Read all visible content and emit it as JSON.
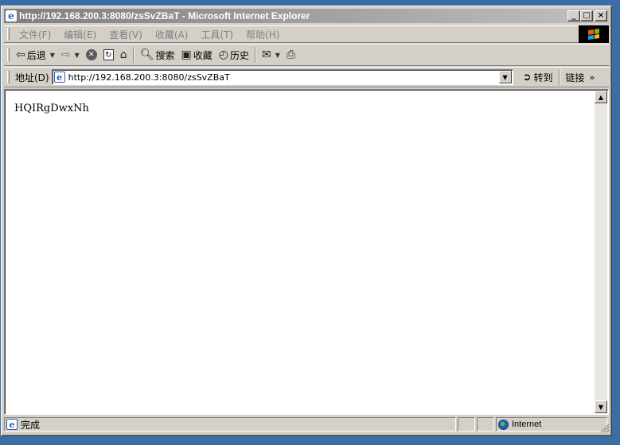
{
  "window": {
    "title": "http://192.168.200.3:8080/zsSvZBaT - Microsoft Internet Explorer",
    "minimize_glyph": "_",
    "maximize_glyph": "□",
    "close_glyph": "×"
  },
  "menu": {
    "items": [
      {
        "label": "文件(F)"
      },
      {
        "label": "编辑(E)"
      },
      {
        "label": "查看(V)"
      },
      {
        "label": "收藏(A)"
      },
      {
        "label": "工具(T)"
      },
      {
        "label": "帮助(H)"
      }
    ]
  },
  "toolbar": {
    "back_label": "后退",
    "search_label": "搜索",
    "favorites_label": "收藏",
    "history_label": "历史"
  },
  "address": {
    "label": "地址(D)",
    "value": "http://192.168.200.3:8080/zsSvZBaT",
    "go_label": "转到",
    "links_label": "链接"
  },
  "content": {
    "text": "HQIRgDwxNh"
  },
  "status": {
    "text": "完成",
    "zone": "Internet"
  },
  "icons": {
    "back": "back-arrow-icon",
    "forward": "forward-arrow-icon",
    "stop": "stop-icon",
    "refresh": "refresh-icon",
    "home": "home-icon",
    "search": "search-icon",
    "favorites": "favorites-icon",
    "history": "history-icon",
    "mail": "mail-icon",
    "print": "print-icon"
  }
}
